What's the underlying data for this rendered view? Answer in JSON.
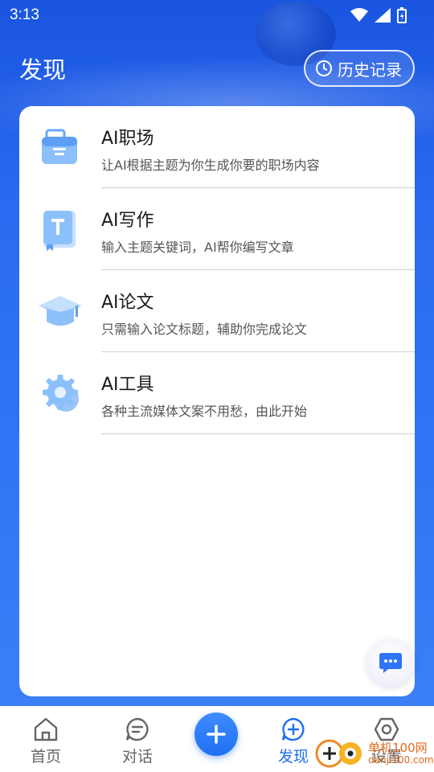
{
  "status": {
    "time": "3:13"
  },
  "header": {
    "title": "发现",
    "history_label": "历史记录"
  },
  "items": [
    {
      "title": "AI职场",
      "desc": "让AI根据主题为你生成你要的职场内容",
      "icon": "briefcase-icon"
    },
    {
      "title": "AI写作",
      "desc": "输入主题关键词，AI帮你编写文章",
      "icon": "book-t-icon"
    },
    {
      "title": "AI论文",
      "desc": "只需输入论文标题，辅助你完成论文",
      "icon": "graduation-cap-icon"
    },
    {
      "title": "AI工具",
      "desc": "各种主流媒体文案不用愁，由此开始",
      "icon": "gear-icon"
    }
  ],
  "nav": {
    "home": "首页",
    "chat": "对话",
    "discover": "发现",
    "settings": "设置"
  },
  "watermark": {
    "line1": "单机100网",
    "line2": "danji100.com"
  },
  "colors": {
    "accent": "#1f6ff2",
    "hero": "#2a6af0"
  }
}
